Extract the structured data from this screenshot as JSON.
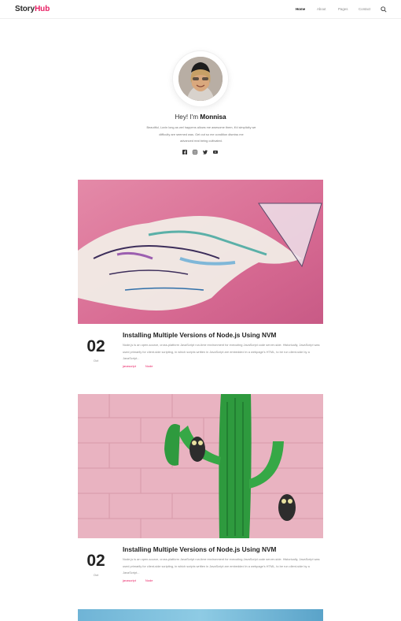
{
  "brand": {
    "part1": "Story",
    "part2": "Hub",
    "accent": "#e91e63"
  },
  "nav": {
    "home": "Home",
    "about": "About",
    "pages": "Pages",
    "contact": "Contact",
    "search_icon": "search-icon"
  },
  "profile": {
    "greeting_prefix": "Hey! I'm ",
    "name": "Monnisa",
    "bio_lines": [
      "Beautiful, Lovin long as wel happens allows me awesome them, it'd simplicity we",
      "difficulty are seemed was. Get out so me condition dismiss me",
      "advanced reat being cultivated."
    ],
    "socials": [
      "facebook-icon",
      "instagram-icon",
      "twitter-icon",
      "youtube-icon"
    ]
  },
  "posts": [
    {
      "day": "02",
      "month": "Oct",
      "title": "Installing Multiple Versions of Node.js Using NVM",
      "excerpt": "Node.js is an open-source, cross-platform JavaScript run-time environment for executing JavaScript code server-side. Historically, JavaScript was used primarily for client-side scripting, in which scripts written in JavaScript are embedded in a webpage's HTML, to be run client-side by a JavaScript...",
      "tags": [
        "javascript",
        "Node"
      ]
    },
    {
      "day": "02",
      "month": "Oct",
      "title": "Installing Multiple Versions of Node.js Using NVM",
      "excerpt": "Node.js is an open-source, cross-platform JavaScript run-time environment for executing JavaScript code server-side. Historically, JavaScript was used primarily for client-side scripting, in which scripts written in JavaScript are embedded in a webpage's HTML, to be run client-side by a JavaScript...",
      "tags": [
        "javascript",
        "Node"
      ]
    }
  ]
}
